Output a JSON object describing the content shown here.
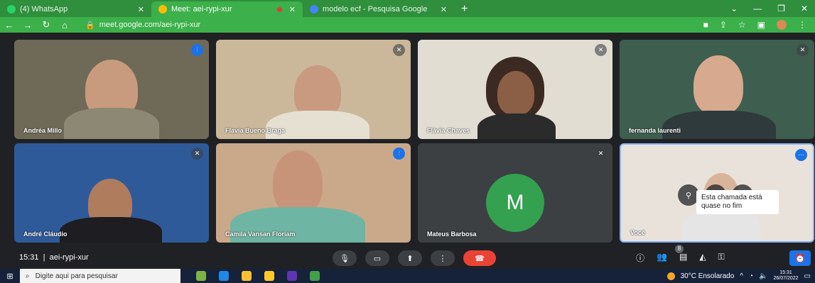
{
  "browser": {
    "tabs": [
      {
        "title": "(4) WhatsApp",
        "color": "#25d366"
      },
      {
        "title": "Meet: aei-rypi-xur",
        "color": "#fbbc04"
      },
      {
        "title": "modelo ecf - Pesquisa Google",
        "color": "#4285f4"
      }
    ],
    "url": "meet.google.com/aei-rypi-xur"
  },
  "participants": [
    {
      "name": "Andréa Millo",
      "status": "speaking",
      "bg": "#8a8066",
      "skin": "#c89a7e"
    },
    {
      "name": "Flavia Bueno Braga",
      "status": "muted",
      "bg": "#cbb89a",
      "skin": "#c99a80"
    },
    {
      "name": "Flávia Chaves",
      "status": "muted",
      "bg": "#e2ddd3",
      "skin": "#8b5e46"
    },
    {
      "name": "fernanda laurenti",
      "status": "muted",
      "bg": "#3e5e4f",
      "skin": "#d7a98e"
    },
    {
      "name": "André Cláudio",
      "status": "muted",
      "bg": "#2e5a9a",
      "skin": "#b07c5e"
    },
    {
      "name": "Camila Vansan Floriam",
      "status": "speaking",
      "bg": "#c9a98a",
      "skin": "#c79479"
    },
    {
      "name": "Mateus Barbosa",
      "status": "muted",
      "bg": "#3c4043",
      "initial": "M"
    },
    {
      "name": "Você",
      "status": "menu",
      "bg": "#e8e2da",
      "skin": "#d8b59a"
    }
  ],
  "tooltip": "Esta chamada está quase no fim",
  "meeting": {
    "time": "15:31",
    "separator": "|",
    "code": "aei-rypi-xur",
    "people_count": "8"
  },
  "taskbar": {
    "search_placeholder": "Digite aqui para pesquisar",
    "weather": "30°C  Ensolarado",
    "clock_time": "15:31",
    "clock_date": "26/07/2022"
  }
}
